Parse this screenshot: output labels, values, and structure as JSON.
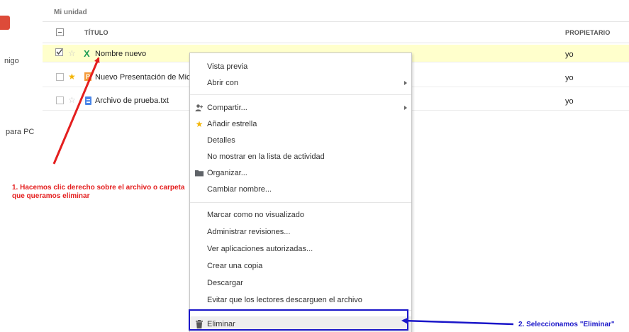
{
  "sidebar": {
    "items": [
      {
        "label": "nigo"
      },
      {
        "label": "para PC"
      }
    ]
  },
  "breadcrumb": "Mi unidad",
  "columns": {
    "title": "TÍTULO",
    "owner": "PROPIETARIO"
  },
  "files": [
    {
      "name": "Nombre nuevo",
      "owner": "yo",
      "type": "spreadsheet",
      "starred": false,
      "selected": true
    },
    {
      "name": "Nuevo Presentación de Micr",
      "owner": "yo",
      "type": "presentation",
      "starred": true,
      "selected": false
    },
    {
      "name": "Archivo de prueba.txt",
      "owner": "yo",
      "type": "document",
      "starred": false,
      "selected": false
    }
  ],
  "context_menu": {
    "items": [
      {
        "label": "Vista previa",
        "icon": "",
        "submenu": false
      },
      {
        "label": "Abrir con",
        "icon": "",
        "submenu": true
      },
      {
        "label": "Compartir...",
        "icon": "share-person-icon",
        "submenu": true
      },
      {
        "label": "Añadir estrella",
        "icon": "star-icon",
        "submenu": false
      },
      {
        "label": "Detalles",
        "icon": "",
        "submenu": false
      },
      {
        "label": "No mostrar en la lista de actividad",
        "icon": "",
        "submenu": false
      },
      {
        "label": "Organizar...",
        "icon": "folder-icon",
        "submenu": false
      },
      {
        "label": "Cambiar nombre...",
        "icon": "",
        "submenu": false
      },
      {
        "label": "Marcar como no visualizado",
        "icon": "",
        "submenu": false
      },
      {
        "label": "Administrar revisiones...",
        "icon": "",
        "submenu": false
      },
      {
        "label": "Ver aplicaciones autorizadas...",
        "icon": "",
        "submenu": false
      },
      {
        "label": "Crear una copia",
        "icon": "",
        "submenu": false
      },
      {
        "label": "Descargar",
        "icon": "",
        "submenu": false
      },
      {
        "label": "Evitar que los lectores descarguen el archivo",
        "icon": "",
        "submenu": false
      },
      {
        "label": "Eliminar",
        "icon": "trash-icon",
        "submenu": false
      }
    ]
  },
  "annotations": {
    "step1": "1. Hacemos clic derecho sobre el archivo o carpeta que queramos eliminar",
    "step2": "2. Seleccionamos \"Eliminar\""
  },
  "colors": {
    "selected_row": "#ffffcc",
    "annotation_red": "#e41e1e",
    "annotation_blue": "#1a16c9",
    "star": "#f4b400",
    "brand": "#dd4b39"
  }
}
